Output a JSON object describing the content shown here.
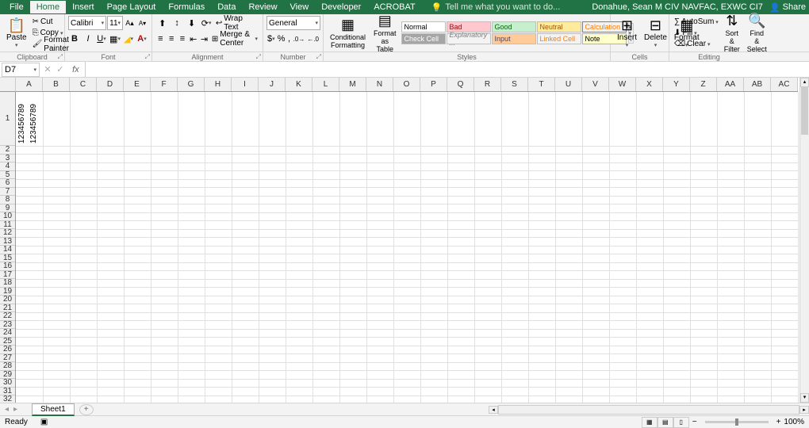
{
  "tabs": {
    "file": "File",
    "home": "Home",
    "insert": "Insert",
    "pagelayout": "Page Layout",
    "formulas": "Formulas",
    "data": "Data",
    "review": "Review",
    "view": "View",
    "developer": "Developer",
    "acrobat": "ACROBAT",
    "tell": "Tell me what you want to do..."
  },
  "user": "Donahue, Sean M CIV NAVFAC, EXWC CI7",
  "share": "Share",
  "clipboard": {
    "paste": "Paste",
    "cut": "Cut",
    "copy": "Copy",
    "fp": "Format Painter",
    "label": "Clipboard"
  },
  "font": {
    "name": "Calibri",
    "size": "11",
    "label": "Font"
  },
  "alignment": {
    "wrap": "Wrap Text",
    "merge": "Merge & Center",
    "label": "Alignment"
  },
  "number": {
    "format": "General",
    "label": "Number"
  },
  "styles": {
    "cf": "Conditional Formatting",
    "fat": "Format as Table",
    "normal": "Normal",
    "bad": "Bad",
    "good": "Good",
    "neutral": "Neutral",
    "calc": "Calculation",
    "check": "Check Cell",
    "expl": "Explanatory ...",
    "input": "Input",
    "linked": "Linked Cell",
    "note": "Note",
    "label": "Styles"
  },
  "cells": {
    "insert": "Insert",
    "delete": "Delete",
    "format": "Format",
    "label": "Cells"
  },
  "editing": {
    "autosum": "AutoSum",
    "fill": "Fill",
    "clear": "Clear",
    "sort": "Sort & Filter",
    "find": "Find & Select",
    "label": "Editing"
  },
  "namebox": "D7",
  "columns": [
    "A",
    "B",
    "C",
    "D",
    "E",
    "F",
    "G",
    "H",
    "I",
    "J",
    "K",
    "L",
    "M",
    "N",
    "O",
    "P",
    "Q",
    "R",
    "S",
    "T",
    "U",
    "V",
    "W",
    "X",
    "Y",
    "Z",
    "AA",
    "AB",
    "AC"
  ],
  "rows": [
    "1",
    "2",
    "3",
    "4",
    "5",
    "6",
    "7",
    "8",
    "9",
    "10",
    "11",
    "12",
    "13",
    "14",
    "15",
    "16",
    "17",
    "18",
    "19",
    "20",
    "21",
    "22",
    "23",
    "24",
    "25",
    "26",
    "27",
    "28",
    "29",
    "30",
    "31",
    "32"
  ],
  "cellA1a": "123456789",
  "cellA1b": "123456789",
  "sheet": "Sheet1",
  "status": "Ready",
  "zoom": "100%"
}
